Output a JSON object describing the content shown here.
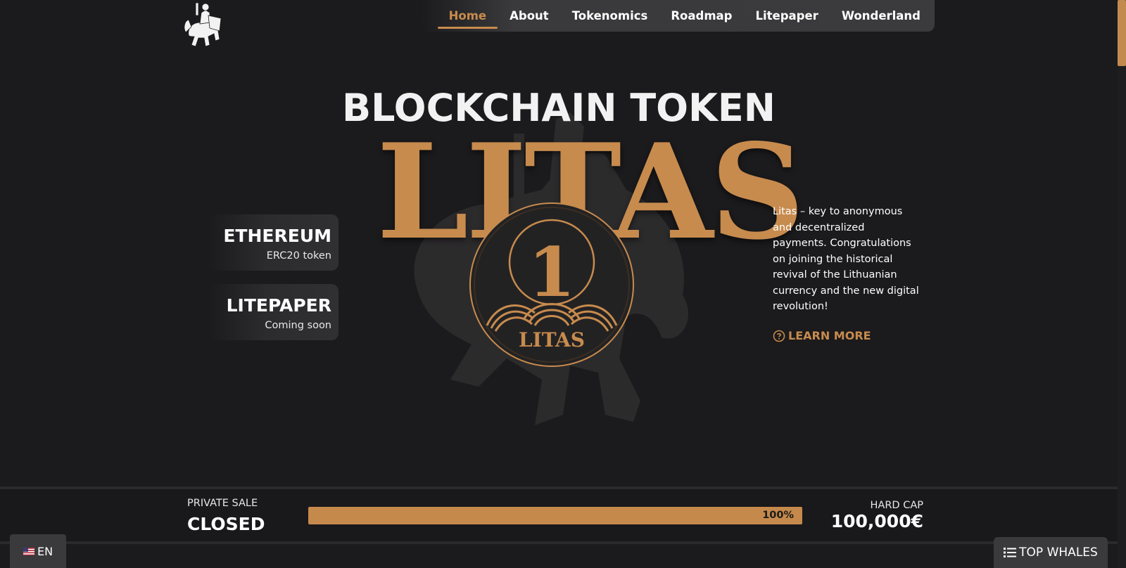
{
  "nav": {
    "items": [
      {
        "label": "Home",
        "active": true
      },
      {
        "label": "About"
      },
      {
        "label": "Tokenomics"
      },
      {
        "label": "Roadmap"
      },
      {
        "label": "Litepaper"
      },
      {
        "label": "Wonderland"
      }
    ]
  },
  "hero": {
    "headline": "BLOCKCHAIN TOKEN",
    "brand": "LITAS",
    "coin_number": "1",
    "coin_label": "LITAS"
  },
  "cards": [
    {
      "title": "ETHEREUM",
      "subtitle": "ERC20 token"
    },
    {
      "title": "LITEPAPER",
      "subtitle": "Coming soon"
    }
  ],
  "description": {
    "text": "Litas – key to anonymous and decentralized payments. Congratulations on joining the historical revival of the Lithuanian currency and the new digital revolution!",
    "learn_more": "LEARN MORE"
  },
  "sale": {
    "label": "PRIVATE SALE",
    "status": "CLOSED",
    "progress_percent": 100,
    "progress_text": "100%",
    "cap_label": "HARD CAP",
    "cap_value": "100,000€"
  },
  "language": {
    "code": "EN"
  },
  "whales": {
    "label": "TOP WHALES"
  },
  "colors": {
    "accent": "#c78b4e",
    "background": "#1b1a1c",
    "panel": "#3a3a3c"
  },
  "icons": {
    "logo": "knight-logo-icon",
    "learn": "question-circle-icon",
    "whales": "list-icon",
    "flag": "us-flag-icon"
  }
}
